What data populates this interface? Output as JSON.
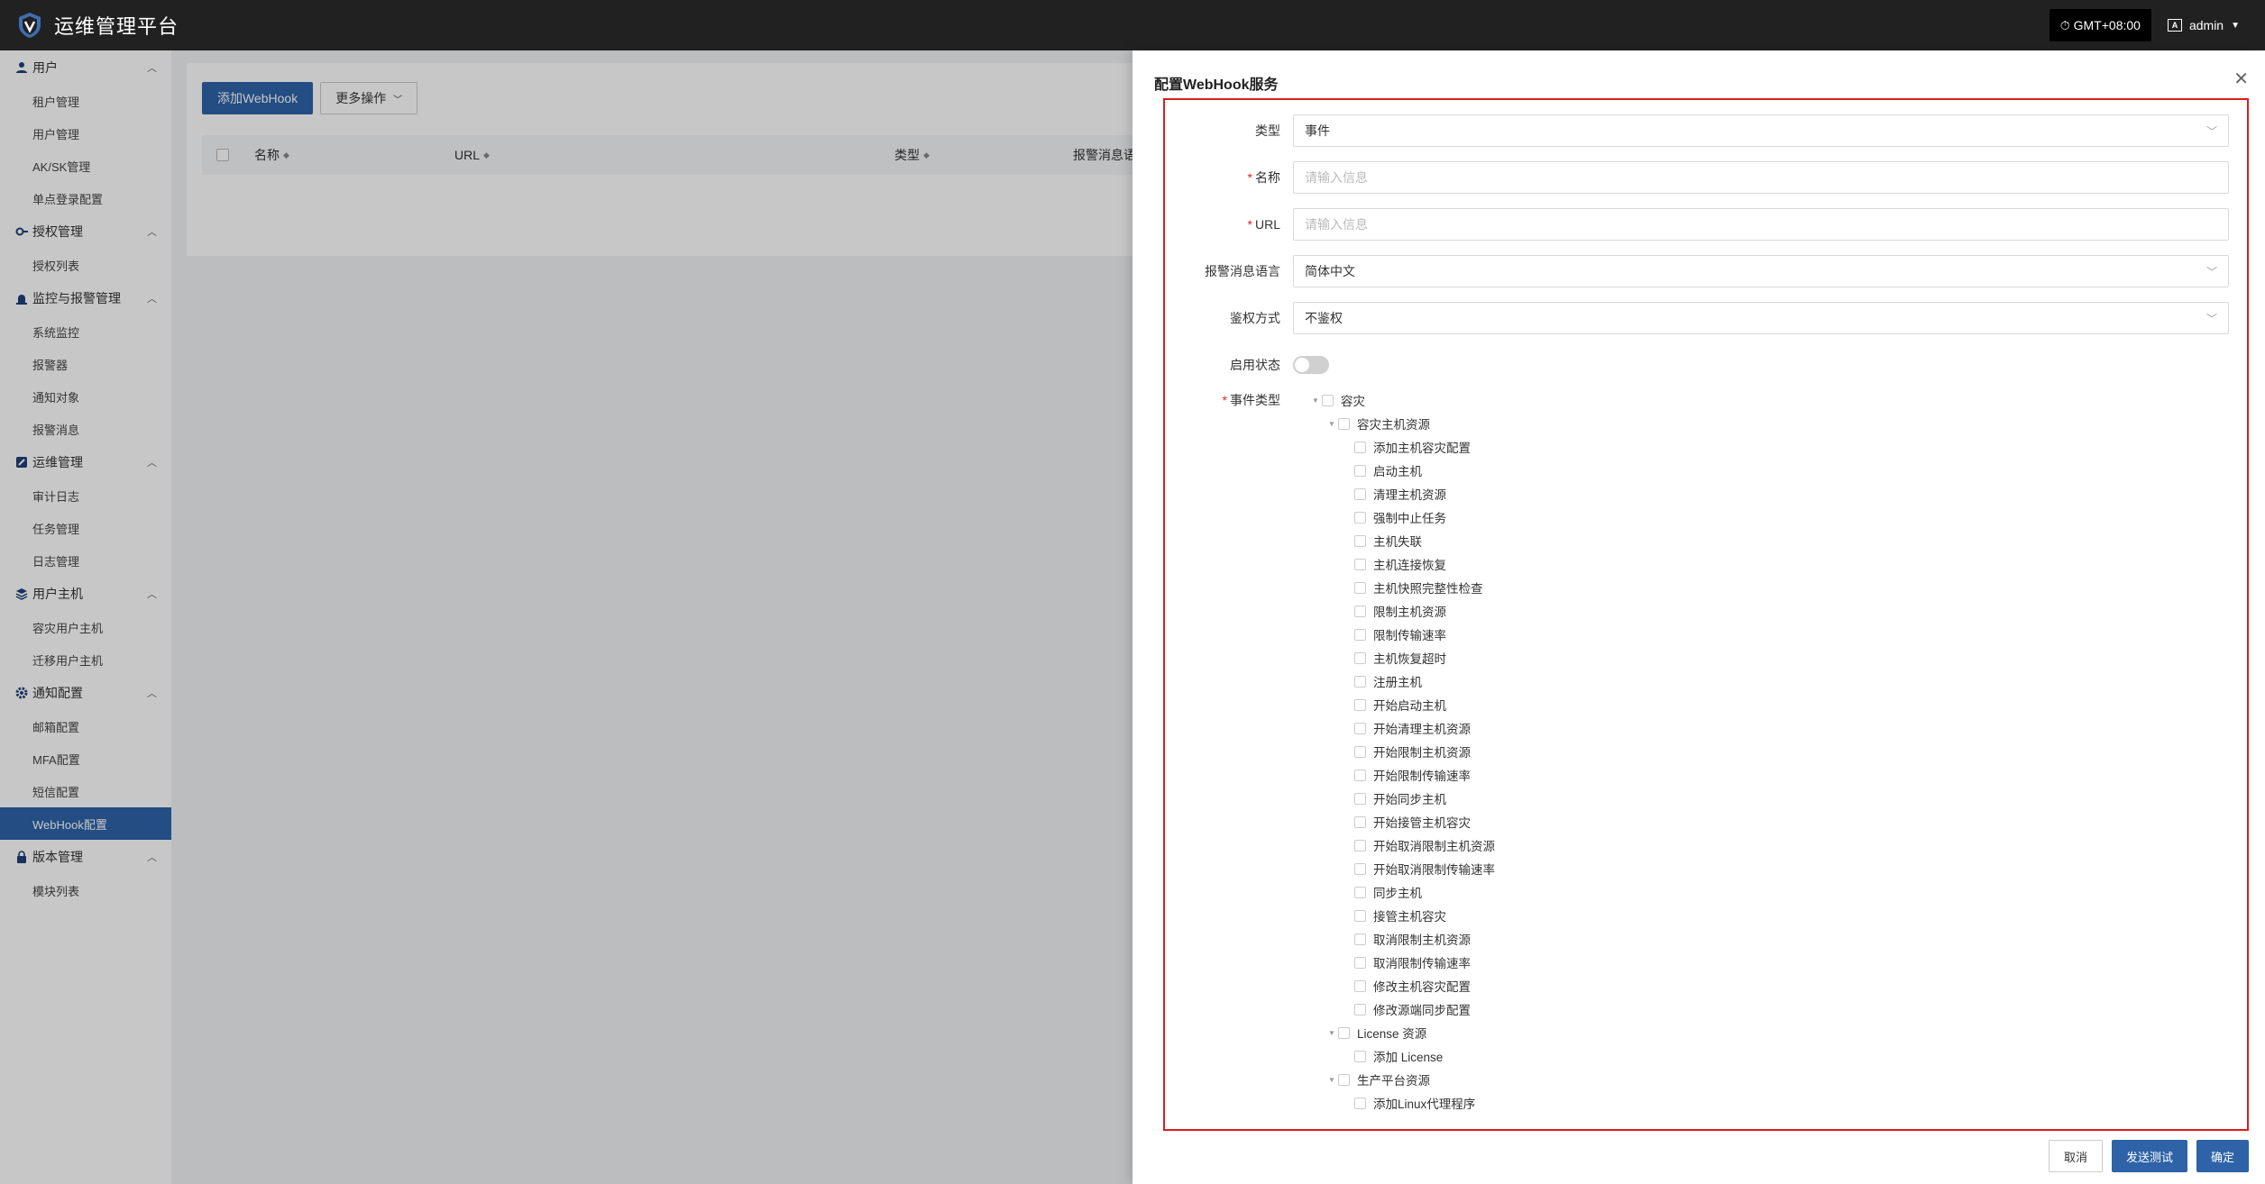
{
  "app": {
    "title": "运维管理平台",
    "timezone": "GMT+08:00",
    "user": "admin"
  },
  "sidebar": {
    "groups": [
      {
        "label": "用户",
        "icon": "user-icon",
        "items": [
          "租户管理",
          "用户管理",
          "AK/SK管理",
          "单点登录配置"
        ]
      },
      {
        "label": "授权管理",
        "icon": "key-icon",
        "items": [
          "授权列表"
        ]
      },
      {
        "label": "监控与报警管理",
        "icon": "alarm-icon",
        "items": [
          "系统监控",
          "报警器",
          "通知对象",
          "报警消息"
        ]
      },
      {
        "label": "运维管理",
        "icon": "tools-icon",
        "items": [
          "审计日志",
          "任务管理",
          "日志管理"
        ]
      },
      {
        "label": "用户主机",
        "icon": "layers-icon",
        "items": [
          "容灾用户主机",
          "迁移用户主机"
        ]
      },
      {
        "label": "通知配置",
        "icon": "gear-icon",
        "items": [
          "邮箱配置",
          "MFA配置",
          "短信配置",
          "WebHook配置"
        ]
      },
      {
        "label": "版本管理",
        "icon": "lock-icon",
        "items": [
          "模块列表"
        ]
      }
    ],
    "active": "WebHook配置"
  },
  "page": {
    "add_label": "添加WebHook",
    "more_label": "更多操作",
    "columns": [
      "名称",
      "URL",
      "类型",
      "报警消息语"
    ]
  },
  "drawer": {
    "title": "配置WebHook服务",
    "fields": {
      "type": {
        "label": "类型",
        "value": "事件"
      },
      "name": {
        "label": "名称",
        "placeholder": "请输入信息"
      },
      "url": {
        "label": "URL",
        "placeholder": "请输入信息"
      },
      "lang": {
        "label": "报警消息语言",
        "value": "简体中文"
      },
      "auth": {
        "label": "鉴权方式",
        "value": "不鉴权"
      },
      "status": {
        "label": "启用状态",
        "enabled": false
      },
      "events": {
        "label": "事件类型"
      }
    },
    "tree": [
      {
        "level": 0,
        "label": "容灾"
      },
      {
        "level": 1,
        "label": "容灾主机资源"
      },
      {
        "level": 2,
        "label": "添加主机容灾配置"
      },
      {
        "level": 2,
        "label": "启动主机"
      },
      {
        "level": 2,
        "label": "清理主机资源"
      },
      {
        "level": 2,
        "label": "强制中止任务"
      },
      {
        "level": 2,
        "label": "主机失联"
      },
      {
        "level": 2,
        "label": "主机连接恢复"
      },
      {
        "level": 2,
        "label": "主机快照完整性检查"
      },
      {
        "level": 2,
        "label": "限制主机资源"
      },
      {
        "level": 2,
        "label": "限制传输速率"
      },
      {
        "level": 2,
        "label": "主机恢复超时"
      },
      {
        "level": 2,
        "label": "注册主机"
      },
      {
        "level": 2,
        "label": "开始启动主机"
      },
      {
        "level": 2,
        "label": "开始清理主机资源"
      },
      {
        "level": 2,
        "label": "开始限制主机资源"
      },
      {
        "level": 2,
        "label": "开始限制传输速率"
      },
      {
        "level": 2,
        "label": "开始同步主机"
      },
      {
        "level": 2,
        "label": "开始接管主机容灾"
      },
      {
        "level": 2,
        "label": "开始取消限制主机资源"
      },
      {
        "level": 2,
        "label": "开始取消限制传输速率"
      },
      {
        "level": 2,
        "label": "同步主机"
      },
      {
        "level": 2,
        "label": "接管主机容灾"
      },
      {
        "level": 2,
        "label": "取消限制主机资源"
      },
      {
        "level": 2,
        "label": "取消限制传输速率"
      },
      {
        "level": 2,
        "label": "修改主机容灾配置"
      },
      {
        "level": 2,
        "label": "修改源端同步配置"
      },
      {
        "level": 1,
        "label": "License 资源"
      },
      {
        "level": 2,
        "label": "添加 License"
      },
      {
        "level": 1,
        "label": "生产平台资源"
      },
      {
        "level": 2,
        "label": "添加Linux代理程序"
      }
    ],
    "buttons": {
      "cancel": "取消",
      "test": "发送测试",
      "ok": "确定"
    }
  }
}
